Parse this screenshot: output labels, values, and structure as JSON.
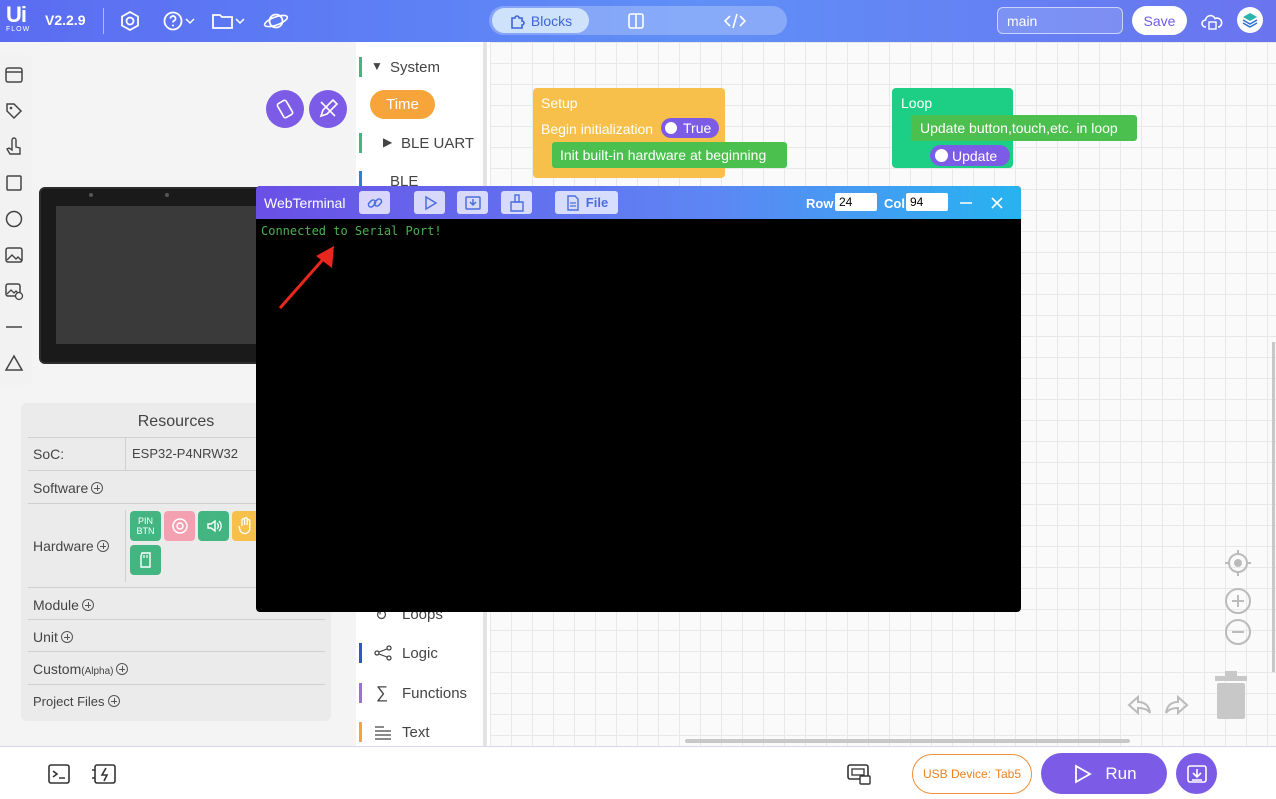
{
  "app": {
    "logo_text": "Ui",
    "logo_sub": "FLOW",
    "version": "V2.2.9"
  },
  "header": {
    "modes": [
      {
        "label": "Blocks",
        "active": true
      },
      {
        "label": "",
        "icon": "split-view-icon"
      },
      {
        "label": "",
        "icon": "code-icon"
      }
    ],
    "branch": "main",
    "save_label": "Save"
  },
  "resources": {
    "title": "Resources",
    "soc_label": "SoC:",
    "soc_value": "ESP32-P4NRW32",
    "software_label": "Software",
    "hardware_label": "Hardware",
    "hardware_chip_pin": "PIN\nBTN",
    "module_label": "Module",
    "unit_label": "Unit",
    "custom_label": "Custom",
    "custom_suffix": "(Alpha)",
    "project_files_label": "Project Files"
  },
  "categories": {
    "system": "System",
    "time": "Time",
    "ble_uart": "BLE UART",
    "ble": "BLE",
    "loops": "Loops",
    "logic": "Logic",
    "functions": "Functions",
    "text": "Text"
  },
  "blocks": {
    "setup": {
      "title": "Setup",
      "begin_label": "Begin initialization",
      "begin_toggle": "True",
      "init_label": "Init built-in hardware at beginning"
    },
    "loop": {
      "title": "Loop",
      "update_label": "Update button,touch,etc. in loop",
      "update_toggle": "Update"
    }
  },
  "terminal": {
    "title": "WebTerminal",
    "file_label": "File",
    "row_label": "Row",
    "row_value": "24",
    "col_label": "Col",
    "col_value": "94",
    "output": "Connected to Serial Port!"
  },
  "bottom": {
    "usb_label": "USB Device:",
    "usb_device": "Tab5",
    "run_label": "Run"
  },
  "colors": {
    "accent": "#7c5ce6",
    "setup_block": "#f7c04a",
    "loop_block": "#1ccf85",
    "green_block": "#4cc04f",
    "terminal_text": "#4caf50",
    "usb_orange": "#ef7f1c"
  }
}
